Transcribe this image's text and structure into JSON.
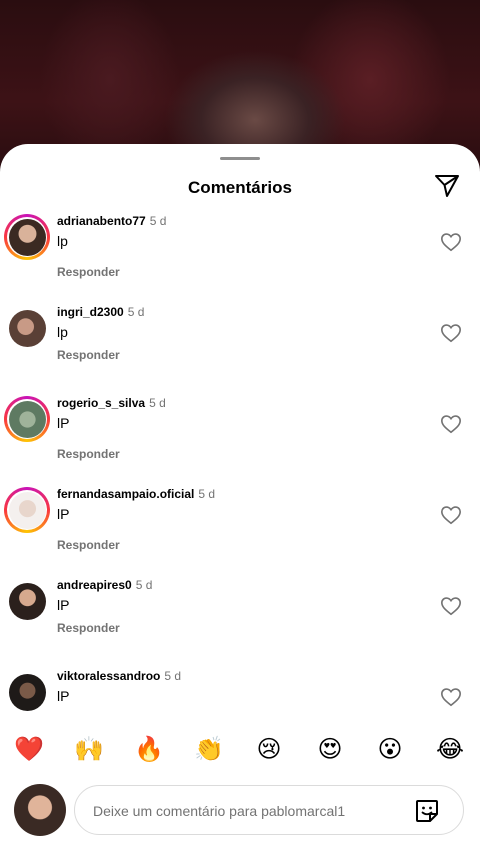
{
  "sheet": {
    "title": "Comentários",
    "send_icon": "paper-plane-icon"
  },
  "comments": [
    {
      "user": "adrianabento77",
      "time": "5 d",
      "text": "lp",
      "reply": "Responder",
      "story_ring": true
    },
    {
      "user": "ingri_d2300",
      "time": "5 d",
      "text": "lp",
      "reply": "Responder",
      "story_ring": false
    },
    {
      "user": "rogerio_s_silva",
      "time": "5 d",
      "text": "lP",
      "reply": "Responder",
      "story_ring": true
    },
    {
      "user": "fernandasampaio.oficial",
      "time": "5 d",
      "text": "lP",
      "reply": "Responder",
      "story_ring": true
    },
    {
      "user": "andreapires0",
      "time": "5 d",
      "text": "lP",
      "reply": "Responder",
      "story_ring": false
    },
    {
      "user": "viktoralessandroo",
      "time": "5 d",
      "text": "lP",
      "reply": "",
      "story_ring": false
    }
  ],
  "emoji_bar": [
    "❤️",
    "🙌",
    "🔥",
    "👏",
    "😢",
    "😍",
    "😮",
    "😂"
  ],
  "composer": {
    "placeholder": "Deixe um comentário para pablomarcal1",
    "sticker_icon": "sticker-icon"
  },
  "colors": {
    "accent_ring_start": "#c913b9",
    "accent_ring_end": "#fec503",
    "muted_text": "#737373"
  }
}
